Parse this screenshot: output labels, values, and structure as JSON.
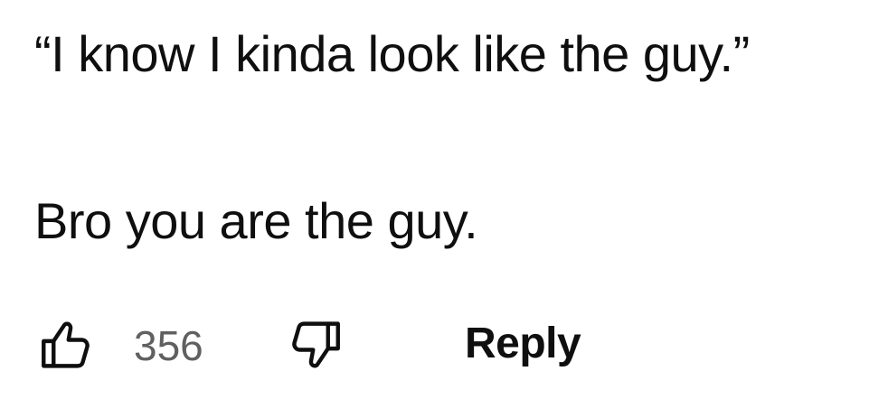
{
  "comment": {
    "lines": [
      "“I know I kinda look like the guy.”",
      "Bro you are the guy."
    ]
  },
  "actions": {
    "like_icon": "thumbs-up-icon",
    "like_count": "356",
    "dislike_icon": "thumbs-down-icon",
    "reply_label": "Reply"
  },
  "colors": {
    "text": "#0f0f0f",
    "count": "#606060",
    "background": "#ffffff"
  }
}
